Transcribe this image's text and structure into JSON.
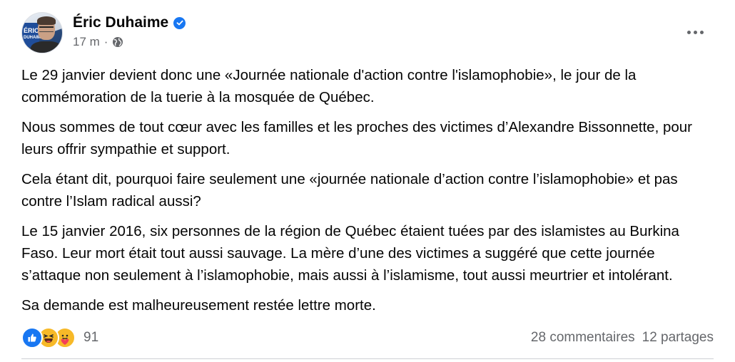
{
  "post": {
    "author": "Éric Duhaime",
    "time": "17 m",
    "separator": "·",
    "avatar_text": [
      "ÉRIC",
      "DUHAIME"
    ],
    "paragraphs": [
      "Le 29 janvier devient donc une «Journée nationale d'action contre l'islamophobie», le jour de la commémoration de la tuerie à la mosquée de Québec.",
      "Nous sommes de tout cœur avec les familles et les proches des victimes d’Alexandre Bissonnette, pour leurs offrir sympathie et support.",
      "Cela étant dit, pourquoi faire seulement une «journée nationale d’action contre l’islamophobie» et pas contre l’Islam radical aussi?",
      "Le 15 janvier 2016, six personnes de la région de Québec étaient tuées par des islamistes au Burkina Faso. Leur mort était tout aussi sauvage. La mère d’une des victimes a suggéré que cette journée s’attaque non seulement à l’islamophobie, mais aussi à l’islamisme, tout aussi meurtrier et intolérant.",
      "Sa demande est malheureusement restée lettre morte."
    ]
  },
  "footer": {
    "reaction_count": "91",
    "comments": "28 commentaires",
    "shares": "12 partages"
  },
  "colors": {
    "accent": "#1877f2",
    "secondary_text": "#65676b",
    "reaction_yellow": "#f7b928"
  },
  "icons": [
    "verified-badge-icon",
    "globe-icon",
    "more-options-icon",
    "like-reaction-icon",
    "haha-reaction-icon",
    "care-reaction-icon"
  ]
}
